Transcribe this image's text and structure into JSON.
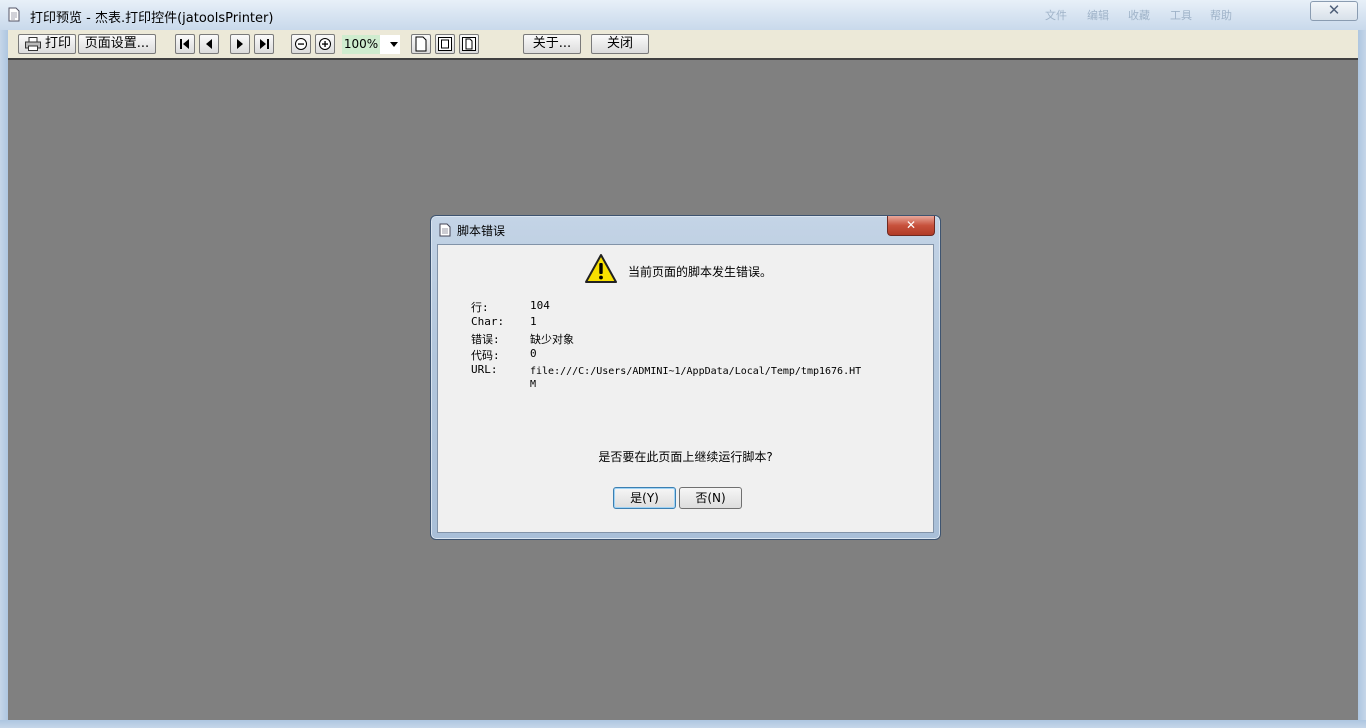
{
  "window": {
    "title": "打印预览 - 杰表.打印控件(jatoolsPrinter)",
    "ghost_items": [
      "文件",
      "编辑",
      "收藏",
      "工具",
      "帮助"
    ],
    "close_glyph": "✕"
  },
  "toolbar": {
    "print_label": "打印",
    "page_setup_label": "页面设置...",
    "zoom_value": "100%",
    "about_label": "关于...",
    "close_label": "关闭"
  },
  "dialog": {
    "title": "脚本错误",
    "close_glyph": "✕",
    "heading": "当前页面的脚本发生错误。",
    "details": [
      {
        "label": "行:",
        "value": "104"
      },
      {
        "label": "Char:",
        "value": "1"
      },
      {
        "label": "错误:",
        "value": "缺少对象"
      },
      {
        "label": "代码:",
        "value": "0"
      }
    ],
    "url_label": "URL:",
    "url_value": "file:///C:/Users/ADMINI~1/AppData/Local/Temp/tmp1676.HTM",
    "question": "是否要在此页面上继续运行脚本?",
    "yes_label": "是(Y)",
    "no_label": "否(N)"
  },
  "colors": {
    "canvas_bg": "#808080",
    "toolbar_bg": "#ece9d8",
    "dialog_body_bg": "#f0f0f0",
    "warning_yellow": "#f8e000",
    "close_red": "#c7513c"
  }
}
